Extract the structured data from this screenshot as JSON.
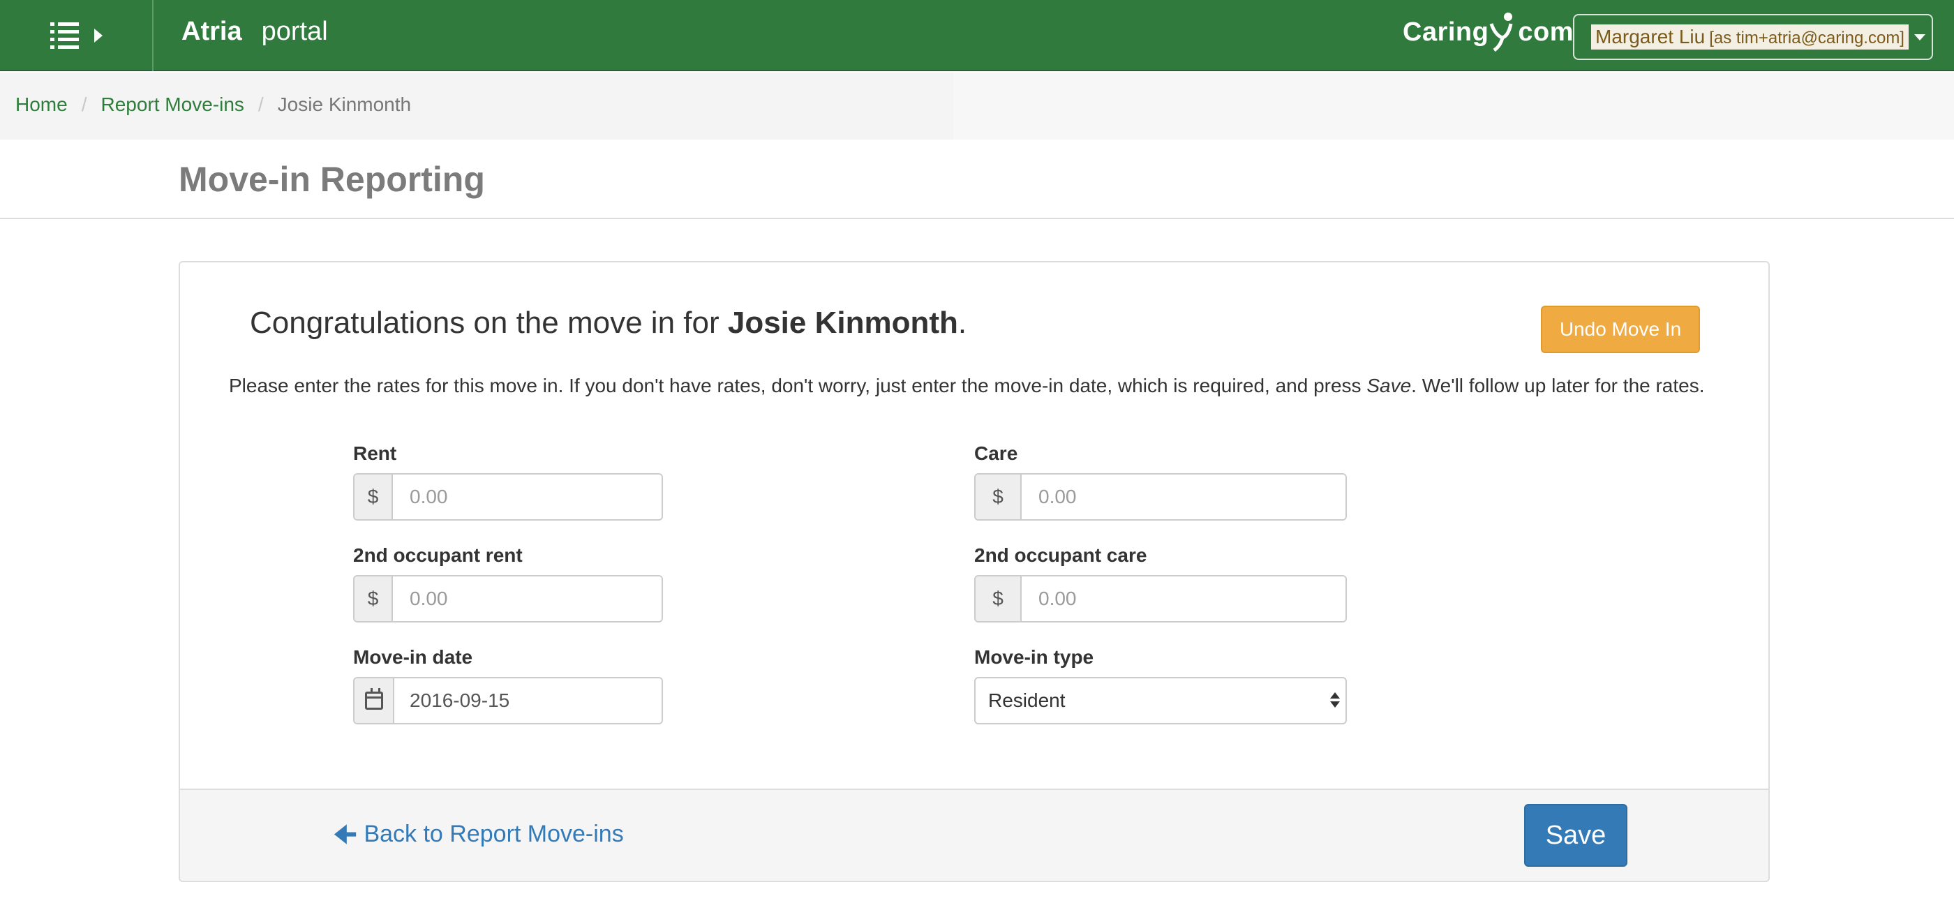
{
  "navbar": {
    "brand_name": "Atria",
    "brand_suffix": "portal",
    "logo_left": "Caring",
    "logo_right": "com",
    "user_name": "Margaret Liu",
    "user_as": "[as tim+atria@caring.com]",
    "color": "#2f7a3c"
  },
  "breadcrumb": {
    "items": [
      "Home",
      "Report Move-ins"
    ],
    "separator": "/",
    "current": "Josie Kinmonth"
  },
  "page": {
    "title": "Move-in Reporting"
  },
  "card": {
    "congrats_prefix": "Congratulations on the move in for ",
    "congrats_name": "Josie Kinmonth",
    "congrats_suffix": ".",
    "undo_label": "Undo Move In",
    "intro_part1": "Please enter the rates for this move in. If you don't have rates, don't worry, just enter the move-in date, which is required, and press ",
    "intro_save_word": "Save",
    "intro_part2": ". We'll follow up later for the rates.",
    "currency_symbol": "$",
    "fields": {
      "rent": {
        "label": "Rent",
        "placeholder": "0.00"
      },
      "care": {
        "label": "Care",
        "placeholder": "0.00"
      },
      "rent2": {
        "label": "2nd occupant rent",
        "placeholder": "0.00"
      },
      "care2": {
        "label": "2nd occupant care",
        "placeholder": "0.00"
      },
      "move_in_date": {
        "label": "Move-in date",
        "value": "2016-09-15"
      },
      "move_in_type": {
        "label": "Move-in type",
        "value": "Resident"
      }
    },
    "back_label": "Back to Report Move-ins",
    "save_label": "Save"
  },
  "colors": {
    "undo": "#efaa42",
    "primary": "#337ab7",
    "link_green": "#2e7d3a"
  }
}
